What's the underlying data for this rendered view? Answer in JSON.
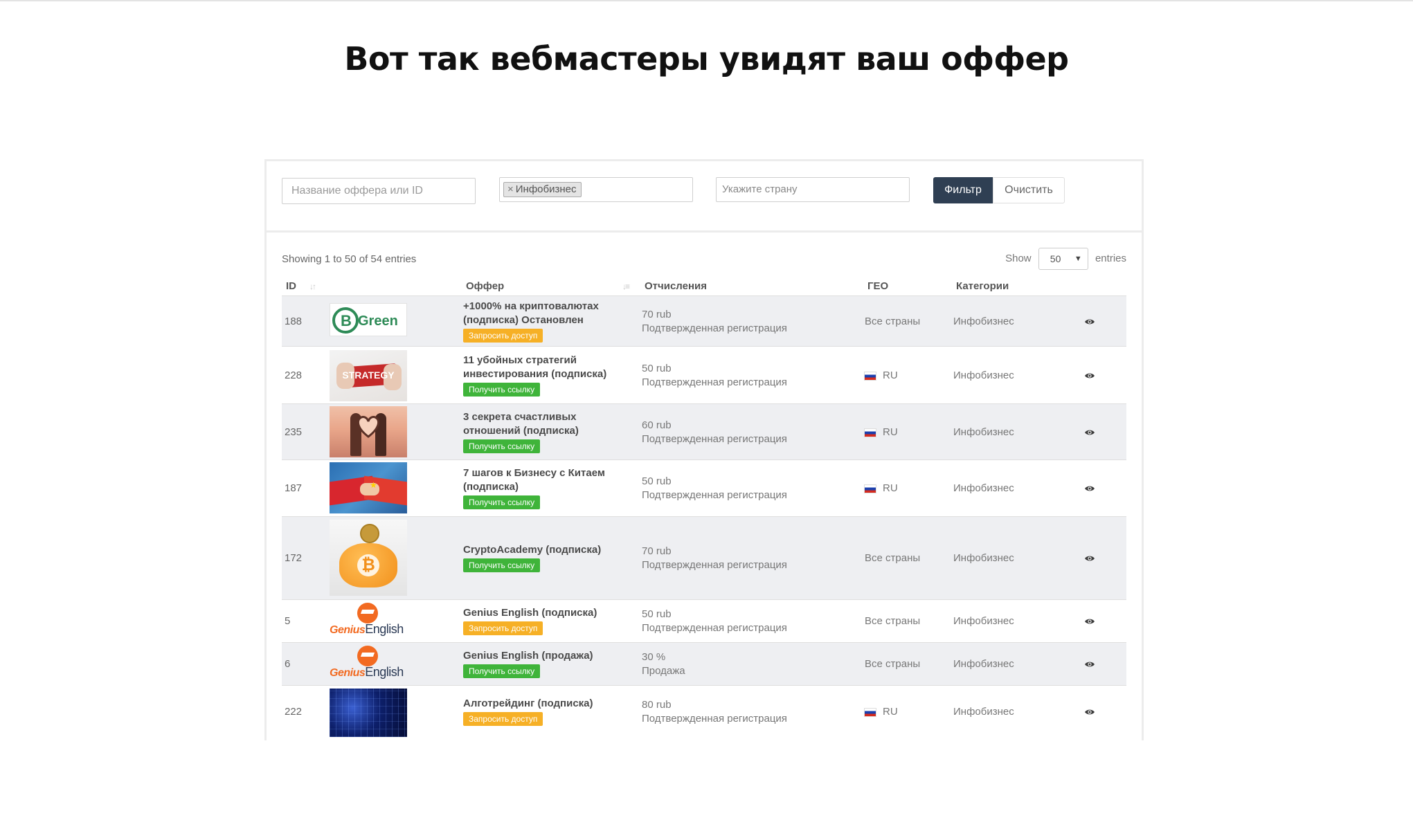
{
  "hero": {
    "title": "Вот так вебмастеры увидят ваш оффер"
  },
  "filters": {
    "name_placeholder": "Название оффера или ID",
    "category_tag": "Инфобизнес",
    "category_tag_remove": "×",
    "country_placeholder": "Укажите страну",
    "filter_button": "Фильтр",
    "clear_button": "Очистить"
  },
  "table_info": {
    "showing": "Showing 1 to 50 of 54 entries",
    "show_label": "Show",
    "page_size": "50",
    "entries_label": "entries"
  },
  "columns": {
    "id": "ID",
    "offer": "Оффер",
    "payout": "Отчисления",
    "geo": "ГЕО",
    "categories": "Категории"
  },
  "rows": [
    {
      "id": "188",
      "thumb": "bcgreen-logo",
      "thumb_text": "Green",
      "title": "+1000% на криптовалютах (подписка) Остановлен",
      "action": "Запросить доступ",
      "action_type": "request",
      "amount": "70 rub",
      "payout_type": "Подтвержденная регистрация",
      "geo": "Все страны",
      "geo_flag": false,
      "category": "Инфобизнес"
    },
    {
      "id": "228",
      "thumb": "strategy-puzzle-image",
      "thumb_text": "STRATEGY",
      "title": "11 убойных стратегий инвестирования (подписка)",
      "action": "Получить ссылку",
      "action_type": "get",
      "amount": "50 rub",
      "payout_type": "Подтвержденная регистрация",
      "geo": "RU",
      "geo_flag": true,
      "category": "Инфобизнес"
    },
    {
      "id": "235",
      "thumb": "couple-heart-image",
      "thumb_text": "",
      "title": "3 секрета счастливых отношений (подписка)",
      "action": "Получить ссылку",
      "action_type": "get",
      "amount": "60 rub",
      "payout_type": "Подтвержденная регистрация",
      "geo": "RU",
      "geo_flag": true,
      "category": "Инфобизнес"
    },
    {
      "id": "187",
      "thumb": "russia-china-handshake-image",
      "thumb_text": "",
      "title": "7 шагов к Бизнесу с Китаем (подписка)",
      "action": "Получить ссылку",
      "action_type": "get",
      "amount": "50 rub",
      "payout_type": "Подтвержденная регистрация",
      "geo": "RU",
      "geo_flag": true,
      "category": "Инфобизнес"
    },
    {
      "id": "172",
      "thumb": "bitcoin-piggybank-image",
      "thumb_text": "",
      "title": "CryptoAcademy (подписка)",
      "action": "Получить ссылку",
      "action_type": "get",
      "amount": "70 rub",
      "payout_type": "Подтвержденная регистрация",
      "geo": "Все страны",
      "geo_flag": false,
      "category": "Инфобизнес"
    },
    {
      "id": "5",
      "thumb": "genius-english-logo",
      "thumb_text": "English",
      "thumb_text2": "Genius",
      "title": "Genius English (подписка)",
      "action": "Запросить доступ",
      "action_type": "request",
      "amount": "50 rub",
      "payout_type": "Подтвержденная регистрация",
      "geo": "Все страны",
      "geo_flag": false,
      "category": "Инфобизнес"
    },
    {
      "id": "6",
      "thumb": "genius-english-logo",
      "thumb_text": "English",
      "thumb_text2": "Genius",
      "title": "Genius English (продажа)",
      "action": "Получить ссылку",
      "action_type": "get",
      "amount": "30 %",
      "payout_type": "Продажа",
      "geo": "Все страны",
      "geo_flag": false,
      "category": "Инфобизнес"
    },
    {
      "id": "222",
      "thumb": "circuit-board-image",
      "thumb_text": "",
      "title": "Алготрейдинг (подписка)",
      "action": "Запросить доступ",
      "action_type": "request",
      "amount": "80 rub",
      "payout_type": "Подтвержденная регистрация",
      "geo": "RU",
      "geo_flag": true,
      "category": "Инфобизнес"
    }
  ],
  "colors": {
    "filter_button": "#2f3f53",
    "request_badge": "#f6b026",
    "get_badge": "#3fb43a",
    "row_stripe": "#eeeff2"
  }
}
